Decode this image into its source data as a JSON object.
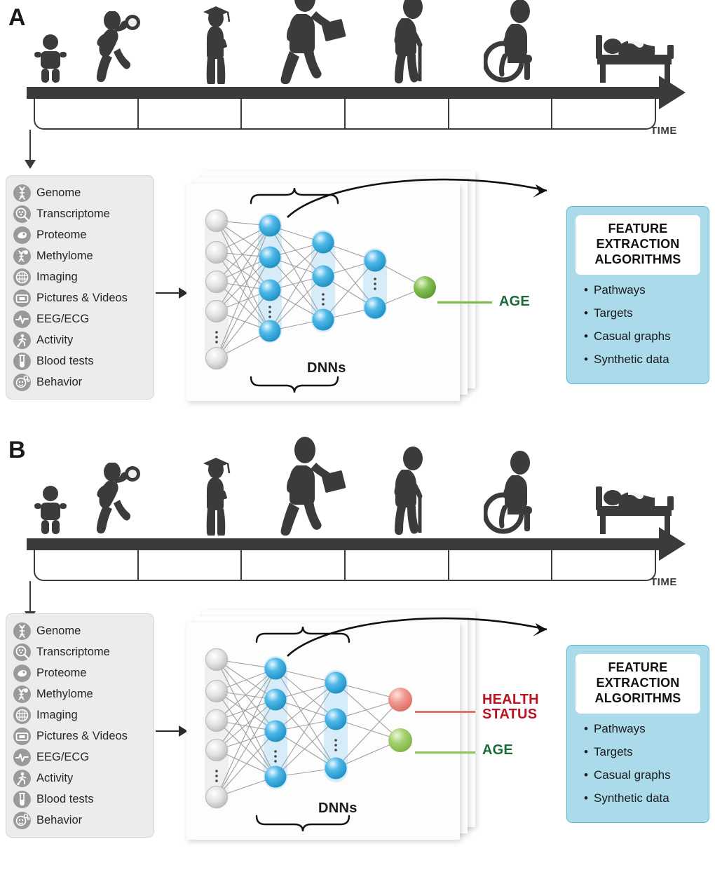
{
  "figure": {
    "panels": [
      {
        "letter": "A",
        "timeline": {
          "axis_label": "TIME",
          "stages": [
            {
              "name": "baby",
              "icon": "baby-icon"
            },
            {
              "name": "child-playing",
              "icon": "child-ball-icon"
            },
            {
              "name": "graduate-student",
              "icon": "graduate-icon"
            },
            {
              "name": "working-adult",
              "icon": "briefcase-adult-icon"
            },
            {
              "name": "elderly-with-cane",
              "icon": "elderly-cane-icon"
            },
            {
              "name": "wheelchair-user",
              "icon": "wheelchair-icon"
            },
            {
              "name": "bedridden-person",
              "icon": "bed-icon"
            }
          ],
          "cells": 6
        },
        "data_types": [
          {
            "label": "Genome",
            "icon": "dna-icon"
          },
          {
            "label": "Transcriptome",
            "icon": "rna-magnifier-icon"
          },
          {
            "label": "Proteome",
            "icon": "protein-icon"
          },
          {
            "label": "Methylome",
            "icon": "methylation-dna-icon"
          },
          {
            "label": "Imaging",
            "icon": "brain-scan-icon"
          },
          {
            "label": "Pictures & Videos",
            "icon": "media-frame-icon"
          },
          {
            "label": "EEG/ECG",
            "icon": "pulse-wave-icon"
          },
          {
            "label": "Activity",
            "icon": "running-person-icon"
          },
          {
            "label": "Blood tests",
            "icon": "test-tube-icon"
          },
          {
            "label": "Behavior",
            "icon": "behavior-head-icon"
          }
        ],
        "network": {
          "label": "DNNs",
          "input_nodes": 6,
          "hidden_layers": [
            {
              "nodes": 4,
              "ellipsis": true
            },
            {
              "nodes": 3,
              "ellipsis": true
            },
            {
              "nodes": 2,
              "ellipsis": true
            }
          ],
          "outputs": [
            {
              "label": "AGE",
              "color": "#1b6b3a",
              "node_color": "#7bb949"
            }
          ]
        },
        "feature_box": {
          "title": "FEATURE\nEXTRACTION\nALGORITHMS",
          "items": [
            "Pathways",
            "Targets",
            "Casual graphs",
            "Synthetic data"
          ],
          "fill": "#abdbea",
          "border": "#57b8d6"
        }
      },
      {
        "letter": "B",
        "timeline": {
          "axis_label": "TIME",
          "stages": [
            {
              "name": "baby",
              "icon": "baby-icon"
            },
            {
              "name": "child-playing",
              "icon": "child-ball-icon"
            },
            {
              "name": "graduate-student",
              "icon": "graduate-icon"
            },
            {
              "name": "working-adult",
              "icon": "briefcase-adult-icon"
            },
            {
              "name": "elderly-with-cane",
              "icon": "elderly-cane-icon"
            },
            {
              "name": "wheelchair-user",
              "icon": "wheelchair-icon"
            },
            {
              "name": "bedridden-person",
              "icon": "bed-icon"
            }
          ],
          "cells": 6
        },
        "data_types": [
          {
            "label": "Genome",
            "icon": "dna-icon"
          },
          {
            "label": "Transcriptome",
            "icon": "rna-magnifier-icon"
          },
          {
            "label": "Proteome",
            "icon": "protein-icon"
          },
          {
            "label": "Methylome",
            "icon": "methylation-dna-icon"
          },
          {
            "label": "Imaging",
            "icon": "brain-scan-icon"
          },
          {
            "label": "Pictures & Videos",
            "icon": "media-frame-icon"
          },
          {
            "label": "EEG/ECG",
            "icon": "pulse-wave-icon"
          },
          {
            "label": "Activity",
            "icon": "running-person-icon"
          },
          {
            "label": "Blood tests",
            "icon": "test-tube-icon"
          },
          {
            "label": "Behavior",
            "icon": "behavior-head-icon"
          }
        ],
        "network": {
          "label": "DNNs",
          "input_nodes": 6,
          "hidden_layers": [
            {
              "nodes": 4,
              "ellipsis": true
            },
            {
              "nodes": 3,
              "ellipsis": true
            }
          ],
          "outputs": [
            {
              "label": "HEALTH\nSTATUS",
              "color": "#bb1420",
              "node_color": "#ef8a85"
            },
            {
              "label": "AGE",
              "color": "#1b6b3a",
              "node_color": "#9acb62"
            }
          ]
        },
        "feature_box": {
          "title": "FEATURE\nEXTRACTION\nALGORITHMS",
          "items": [
            "Pathways",
            "Targets",
            "Casual graphs",
            "Synthetic data"
          ],
          "fill": "#abdbea",
          "border": "#57b8d6"
        }
      }
    ],
    "colors": {
      "dark": "#3b3b3b",
      "node_input": "#d4d4d4",
      "node_hidden": "#36a8dd",
      "hidden_pill": "#d6ecf8",
      "connection": "#9a9a9a"
    }
  }
}
